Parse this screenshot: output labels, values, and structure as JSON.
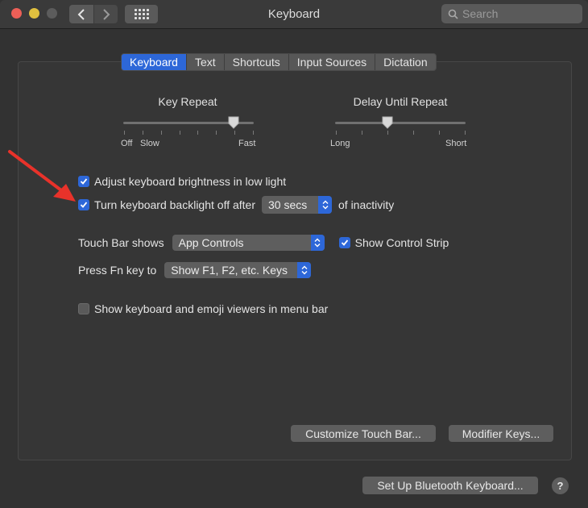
{
  "window": {
    "title": "Keyboard"
  },
  "search": {
    "placeholder": "Search"
  },
  "tabs": [
    {
      "label": "Keyboard",
      "active": true
    },
    {
      "label": "Text",
      "active": false
    },
    {
      "label": "Shortcuts",
      "active": false
    },
    {
      "label": "Input Sources",
      "active": false
    },
    {
      "label": "Dictation",
      "active": false
    }
  ],
  "key_repeat": {
    "title": "Key Repeat",
    "labels": {
      "off": "Off",
      "slow": "Slow",
      "fast": "Fast"
    },
    "level": 0.85
  },
  "delay_until_repeat": {
    "title": "Delay Until Repeat",
    "labels": {
      "long": "Long",
      "short": "Short"
    },
    "level": 0.4
  },
  "options": {
    "adjust_brightness": {
      "label": "Adjust keyboard brightness in low light",
      "checked": true
    },
    "backlight_off": {
      "label": "Turn keyboard backlight off after",
      "checked": true,
      "value": "30 secs",
      "suffix": "of inactivity"
    },
    "touch_bar": {
      "label": "Touch Bar shows",
      "value": "App Controls",
      "control_strip_label": "Show Control Strip",
      "control_strip_checked": true
    },
    "fn_key": {
      "label": "Press Fn key to",
      "value": "Show F1, F2, etc. Keys"
    },
    "emoji_viewers": {
      "label": "Show keyboard and emoji viewers in menu bar",
      "checked": false
    }
  },
  "buttons": {
    "customize_touch_bar": "Customize Touch Bar...",
    "modifier_keys": "Modifier Keys...",
    "bluetooth": "Set Up Bluetooth Keyboard...",
    "help": "?"
  },
  "colors": {
    "accent": "#2d67d8",
    "annotation_arrow": "#e8322a"
  }
}
